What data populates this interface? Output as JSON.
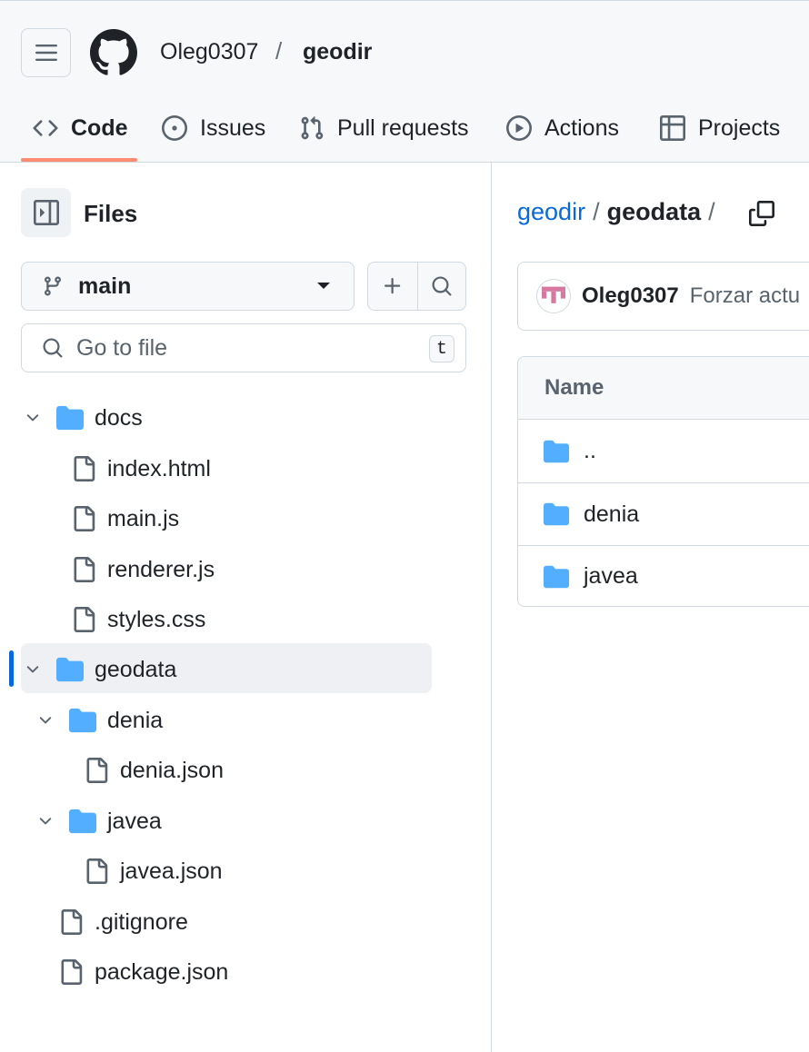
{
  "header": {
    "owner": "Oleg0307",
    "separator": "/",
    "repo": "geodir",
    "tabs": [
      {
        "label": "Code",
        "icon": "code-icon",
        "active": true
      },
      {
        "label": "Issues",
        "icon": "issue-opened-icon"
      },
      {
        "label": "Pull requests",
        "icon": "git-pull-request-icon"
      },
      {
        "label": "Actions",
        "icon": "play-icon"
      },
      {
        "label": "Projects",
        "icon": "table-icon"
      }
    ]
  },
  "sidebar": {
    "title": "Files",
    "branch": "main",
    "search_placeholder": "Go to file",
    "search_shortcut": "t",
    "tree": [
      {
        "label": "docs",
        "type": "folder",
        "expanded": true
      },
      {
        "label": "index.html",
        "type": "file"
      },
      {
        "label": "main.js",
        "type": "file"
      },
      {
        "label": "renderer.js",
        "type": "file"
      },
      {
        "label": "styles.css",
        "type": "file"
      },
      {
        "label": "geodata",
        "type": "folder",
        "expanded": true,
        "selected": true
      },
      {
        "label": "denia",
        "type": "folder",
        "expanded": true
      },
      {
        "label": "denia.json",
        "type": "file"
      },
      {
        "label": "javea",
        "type": "folder",
        "expanded": true
      },
      {
        "label": "javea.json",
        "type": "file"
      },
      {
        "label": ".gitignore",
        "type": "file"
      },
      {
        "label": "package.json",
        "type": "file"
      }
    ]
  },
  "main": {
    "breadcrumb": {
      "root": "geodir",
      "current": "geodata",
      "sep": "/"
    },
    "commit": {
      "author": "Oleg0307",
      "message": "Forzar actu"
    },
    "table": {
      "header_name": "Name",
      "rows": [
        {
          "name": "..",
          "type": "folder"
        },
        {
          "name": "denia",
          "type": "folder"
        },
        {
          "name": "javea",
          "type": "folder"
        }
      ]
    }
  },
  "colors": {
    "accent_link": "#0969da",
    "folder": "#54aeff",
    "active_tab_underline": "#fd8c73",
    "selected_bar": "#0969da"
  }
}
